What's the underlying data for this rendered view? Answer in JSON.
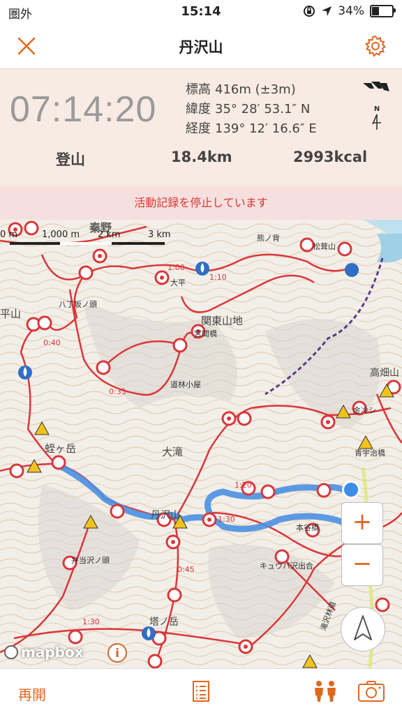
{
  "status": {
    "carrier": "圏外",
    "time": "15:14",
    "battery_text": "34%",
    "battery_level": 0.34
  },
  "nav": {
    "title": "丹沢山"
  },
  "tracking": {
    "elapsed": "07:14:20",
    "elevation_label": "標高",
    "elevation_value": "416m (±3m)",
    "latitude_label": "緯度",
    "latitude_value": "35° 28′ 53.1″ N",
    "longitude_label": "経度",
    "longitude_value": "139° 12′ 16.6″ E",
    "compass_label": "N"
  },
  "stats": {
    "activity": "登山",
    "distance": "18.4km",
    "calories": "2993kcal"
  },
  "banner": {
    "text": "活動記録を停止しています"
  },
  "map": {
    "scale": {
      "label_0": "0 m",
      "label_1": "1,000 m",
      "label_2": "2 km",
      "label_3": "3 km"
    },
    "zoom_in": "+",
    "zoom_out": "−",
    "attribution": "mapbox",
    "info": "i",
    "place_labels": [
      "秦野",
      "大平",
      "関東山地",
      "宮間橋",
      "八丁坂ノ頭",
      "道林小屋",
      "大滝",
      "蛭ヶ岳",
      "丹沢山",
      "弁当沢ノ頭",
      "塔ノ岳",
      "キュウバ沢出合",
      "高畑山",
      "青宇治橋",
      "松茸山",
      "熊ノ背",
      "平山",
      "金冷シ",
      "本谷橋",
      "滝沢林道",
      "1:00",
      "1:20",
      "1:30",
      "0:45",
      "0:40",
      "1:10",
      "0:35"
    ],
    "route_color": "#4a90e2",
    "trail_color": "#d9373a"
  },
  "tabbar": {
    "resume": "再開"
  },
  "colors": {
    "accent": "#e0671e",
    "pause_text": "#d9372f",
    "panel_bg": "#f8ebe4"
  }
}
